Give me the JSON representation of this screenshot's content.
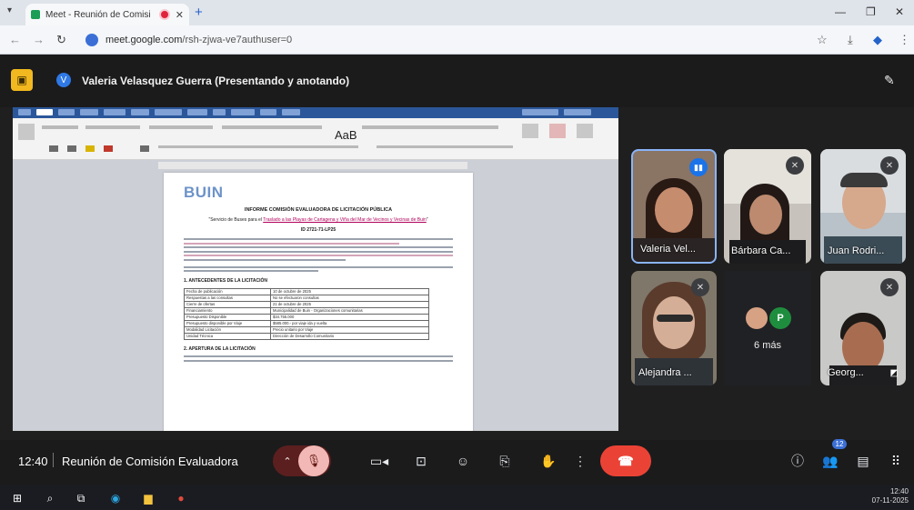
{
  "browser": {
    "tab_title": "Meet - Reunión de Comisi",
    "url_domain": "meet.google.com",
    "url_path": "/rsh-zjwa-ve7authuser=0"
  },
  "meet": {
    "presenter_initial": "V",
    "presenter_label": "Valeria Velasquez Guerra (Presentando y anotando)"
  },
  "document": {
    "logo_text": "BUIN",
    "heading": "INFORME COMISIÓN EVALUADORA DE LICITACIÓN PÚBLICA",
    "subtitle_prefix": "\"Servicio de Buses para el ",
    "subtitle_highlight": "Traslado a las Playas de Cartagena y Viña del Mar de Vecinos y Vecinas de Buin",
    "subtitle_suffix": "\"",
    "id_label": "ID 2721-71-LP25",
    "section1": "1.     ANTECEDENTES DE LA LICITACIÓN",
    "section2": "2.     APERTURA DE LA LICITACIÓN",
    "table": [
      [
        "Fecha de publicación",
        "10 de octubre de 2025"
      ],
      [
        "Respuestas a las consultas",
        "No se efectuaron consultas"
      ],
      [
        "Cierre de ofertas",
        "21 de octubre de 2025"
      ],
      [
        "Financiamiento",
        "Municipalidad de Buin - Organizaciones comunitarias"
      ],
      [
        "Presupuesto Disponible",
        "$34.755.000"
      ],
      [
        "Presupuesto disponible por Viaje",
        "$585.000.- por viaje ida y vuelta"
      ],
      [
        "Modalidad Licitación",
        "Precio unitario por Viaje"
      ],
      [
        "Unidad Técnica",
        "Dirección de Desarrollo Comunitario"
      ]
    ]
  },
  "participants": [
    {
      "name": "Valeria Vel..."
    },
    {
      "name": "Bárbara Ca..."
    },
    {
      "name": "Juan Rodri..."
    },
    {
      "name": "Alejandra ..."
    },
    {
      "name": "Georg..."
    }
  ],
  "more_participants": {
    "label": "6 más",
    "avatar_initial": "P"
  },
  "controls": {
    "time": "12:40",
    "meeting_title": "Reunión de Comisión Evaluadora",
    "participants_badge": "12"
  },
  "taskbar": {
    "time": "12:40",
    "date": "07-11-2025"
  },
  "colors": {
    "meet_bg": "#1b1b1c",
    "hangup": "#ea4335",
    "mic_off_bg": "#f2b8b5",
    "presenting_badge": "#f2b81f",
    "speaking": "#1a73e8",
    "word_blue": "#2b579a"
  }
}
